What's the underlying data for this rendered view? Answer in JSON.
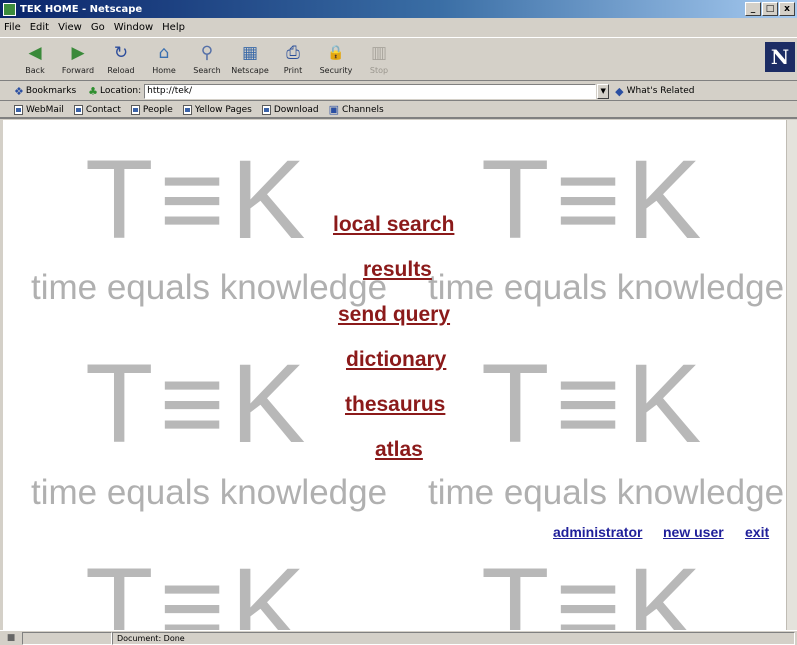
{
  "window": {
    "title": "TEK HOME - Netscape",
    "controls": [
      "_",
      "□",
      "x"
    ]
  },
  "menu": [
    "File",
    "Edit",
    "View",
    "Go",
    "Window",
    "Help"
  ],
  "toolbar": [
    {
      "label": "Back",
      "icon": "back-arrow-icon",
      "glyph": "◀"
    },
    {
      "label": "Forward",
      "icon": "forward-arrow-icon",
      "glyph": "▶"
    },
    {
      "label": "Reload",
      "icon": "reload-icon",
      "glyph": "↻"
    },
    {
      "label": "Home",
      "icon": "home-icon",
      "glyph": "⌂"
    },
    {
      "label": "Search",
      "icon": "search-icon",
      "glyph": "⚲"
    },
    {
      "label": "Netscape",
      "icon": "netscape-icon",
      "glyph": "▦"
    },
    {
      "label": "Print",
      "icon": "print-icon",
      "glyph": "⎙"
    },
    {
      "label": "Security",
      "icon": "security-icon",
      "glyph": "🔒"
    },
    {
      "label": "Stop",
      "icon": "stop-icon",
      "glyph": "▥"
    }
  ],
  "brand_letter": "N",
  "location": {
    "bookmarks_label": "Bookmarks",
    "location_label": "Location:",
    "url": "http://tek/",
    "related_label": "What's Related"
  },
  "links": [
    "WebMail",
    "Contact",
    "People",
    "Yellow Pages",
    "Download",
    "Channels"
  ],
  "page": {
    "logo_text": "T≡K",
    "tagline": "time equals knowledge",
    "menu_links": [
      "local search",
      "results",
      "send query",
      "dictionary",
      "thesaurus",
      "atlas"
    ],
    "nav_links": [
      "administrator",
      "new user",
      "exit"
    ]
  },
  "status": {
    "text": "Document: Done"
  },
  "colors": {
    "menu_link": "#8b1a1a",
    "nav_link": "#1f1f9a",
    "background_text": "#b8b8b8"
  }
}
